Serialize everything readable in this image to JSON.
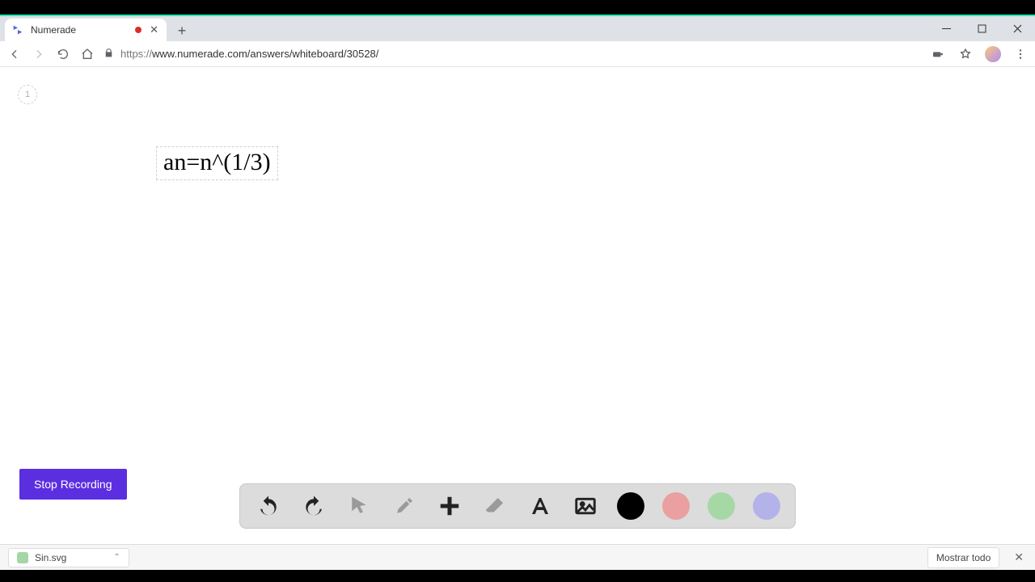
{
  "tab": {
    "title": "Numerade",
    "recording": true
  },
  "address_bar": {
    "protocol": "https://",
    "url": "www.numerade.com/answers/whiteboard/30528/"
  },
  "page": {
    "badge": "1",
    "formula_text": "an=n^(1/3)",
    "stop_recording_label": "Stop Recording"
  },
  "whiteboard_toolbar": {
    "tools": [
      {
        "name": "undo"
      },
      {
        "name": "redo"
      },
      {
        "name": "pointer",
        "muted": true
      },
      {
        "name": "brush",
        "muted": true
      },
      {
        "name": "add"
      },
      {
        "name": "eraser",
        "muted": true
      },
      {
        "name": "text"
      },
      {
        "name": "image"
      }
    ],
    "colors": [
      {
        "name": "black",
        "hex": "#000000"
      },
      {
        "name": "red",
        "hex": "#eaa0a0"
      },
      {
        "name": "green",
        "hex": "#a6d8a6"
      },
      {
        "name": "purple",
        "hex": "#b3b3ea"
      }
    ]
  },
  "download_bar": {
    "file": "Sin.svg",
    "show_all": "Mostrar todo"
  }
}
